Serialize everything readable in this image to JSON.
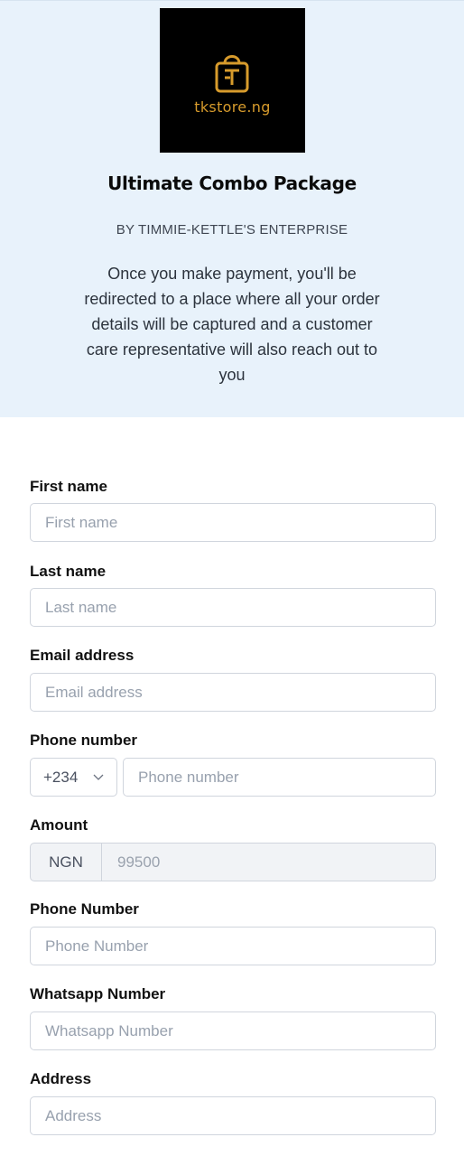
{
  "header": {
    "logo_text": "tkstore.ng",
    "title": "Ultimate Combo Package",
    "byline": "BY TIMMIE-KETTLE'S ENTERPRISE",
    "description": "Once you make payment, you'll be redirected to a place where all your order details will be captured and a customer care representative will also reach out to you"
  },
  "form": {
    "first_name": {
      "label": "First name",
      "placeholder": "First name"
    },
    "last_name": {
      "label": "Last name",
      "placeholder": "Last name"
    },
    "email": {
      "label": "Email address",
      "placeholder": "Email address"
    },
    "phone": {
      "label": "Phone number",
      "country_code": "+234",
      "placeholder": "Phone number"
    },
    "amount": {
      "label": "Amount",
      "currency": "NGN",
      "value": "99500"
    },
    "phone2": {
      "label": "Phone Number",
      "placeholder": "Phone Number"
    },
    "whatsapp": {
      "label": "Whatsapp Number",
      "placeholder": "Whatsapp Number"
    },
    "address": {
      "label": "Address",
      "placeholder": "Address"
    }
  },
  "colors": {
    "hero_bg": "#e8f2fb",
    "logo_bg": "#000000",
    "logo_gold": "#d79b2c",
    "input_border": "#d0d5dd",
    "disabled_bg": "#f1f3f6"
  },
  "icons": {
    "logo": "shopping-bag-icon",
    "country_dropdown": "chevron-down-icon"
  }
}
